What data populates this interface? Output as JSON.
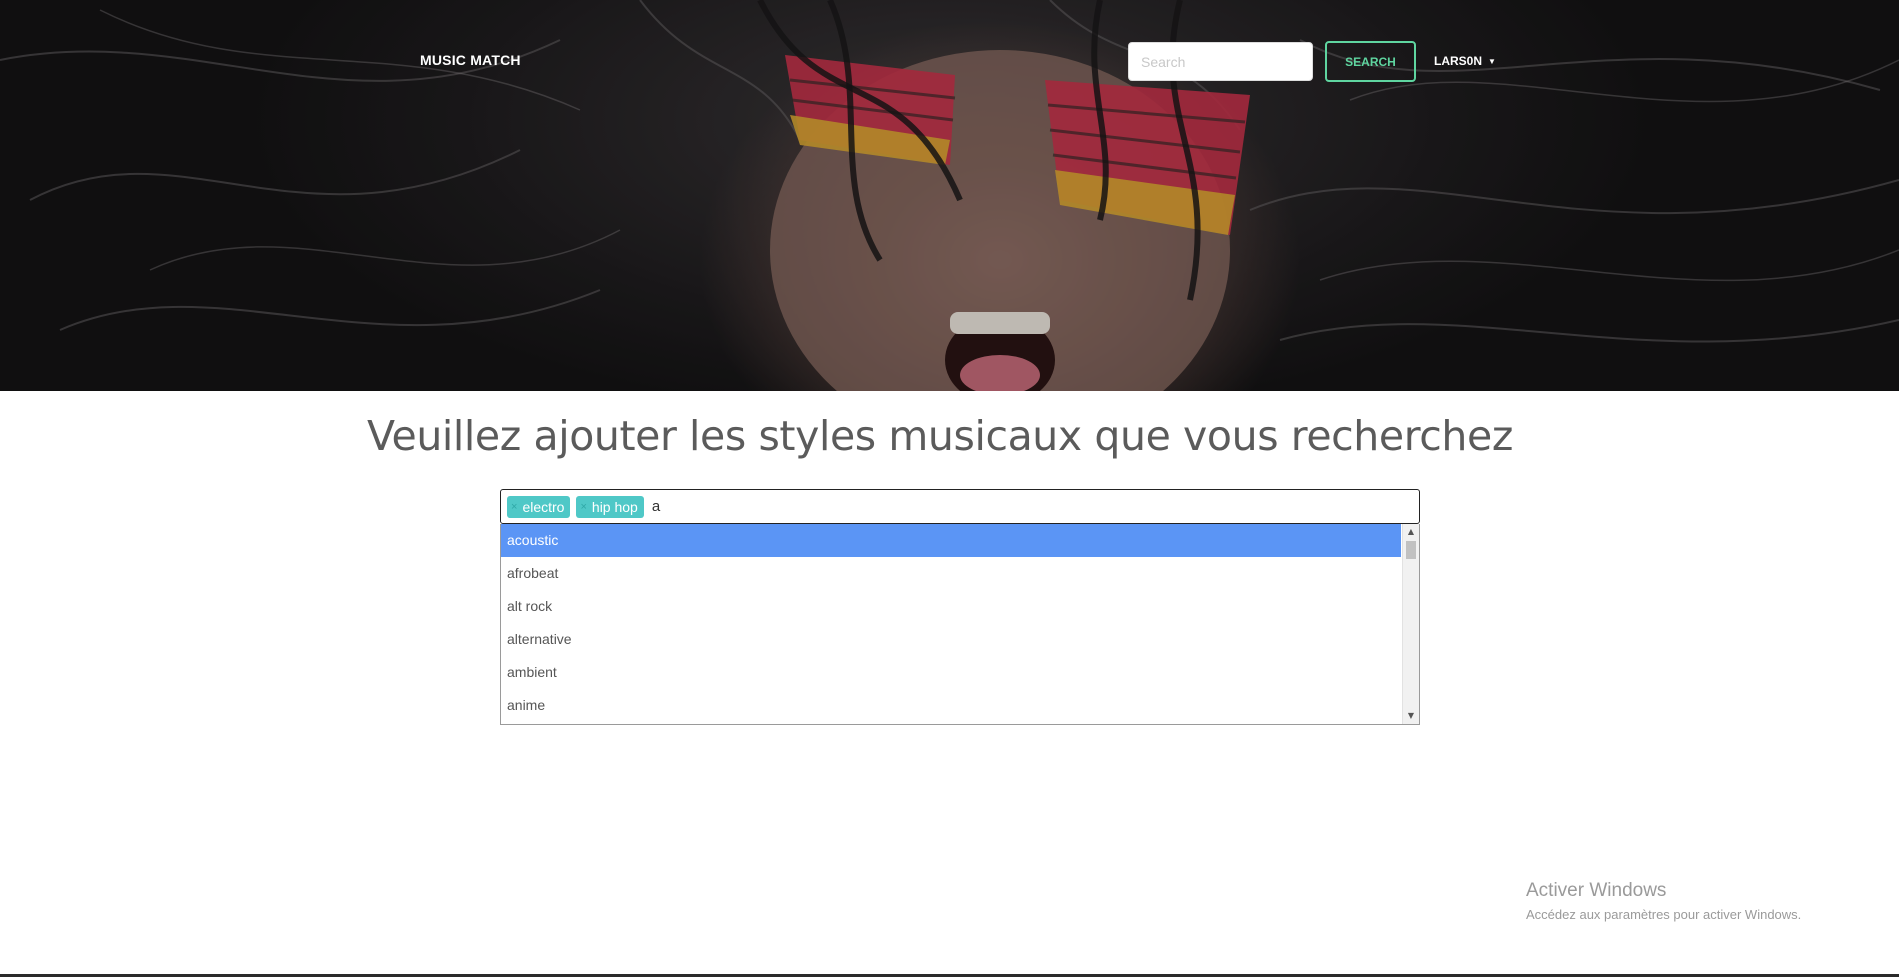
{
  "navbar": {
    "brand": "MUSIC MATCH",
    "search_placeholder": "Search",
    "search_button": "SEARCH",
    "user": "LARS0N",
    "accent_color": "#5fd5a0"
  },
  "main": {
    "heading": "Veuillez ajouter les styles musicaux que vous recherchez",
    "tags": [
      {
        "label": "electro"
      },
      {
        "label": "hip hop"
      }
    ],
    "input_value": "a",
    "tag_color": "#4fc8c7",
    "options": [
      {
        "label": "acoustic",
        "highlighted": true
      },
      {
        "label": "afrobeat"
      },
      {
        "label": "alt rock"
      },
      {
        "label": "alternative"
      },
      {
        "label": "ambient"
      },
      {
        "label": "anime"
      }
    ],
    "highlight_color": "#5b95f5"
  },
  "watermark": {
    "title": "Activer Windows",
    "subtitle": "Accédez aux paramètres pour activer Windows."
  }
}
